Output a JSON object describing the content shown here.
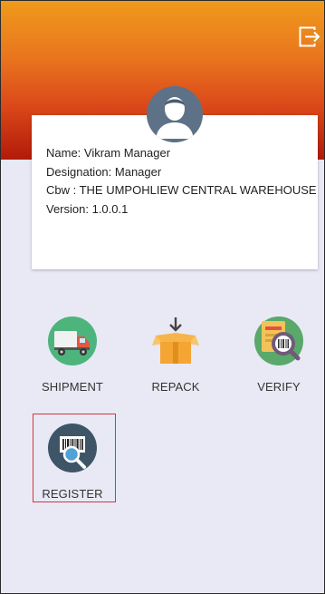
{
  "profile": {
    "name": "Name: Vikram Manager",
    "designation": "Designation: Manager",
    "cbw": "Cbw : THE UMPOHLIEW CENTRAL WAREHOUSE",
    "version": "Version: 1.0.0.1"
  },
  "menu": {
    "shipment": "SHIPMENT",
    "repack": "REPACK",
    "verify": "VERIFY",
    "register": "REGISTER"
  },
  "colors": {
    "header_top": "#ef9a1c",
    "header_bottom": "#b21a0a",
    "background": "#e9e9f5",
    "highlight": "#d9333f"
  },
  "icons": {
    "logout": "logout-icon",
    "avatar": "user-avatar-icon",
    "shipment": "truck-icon",
    "repack": "box-download-icon",
    "verify": "barcode-magnifier-icon",
    "register": "barcode-search-icon"
  }
}
